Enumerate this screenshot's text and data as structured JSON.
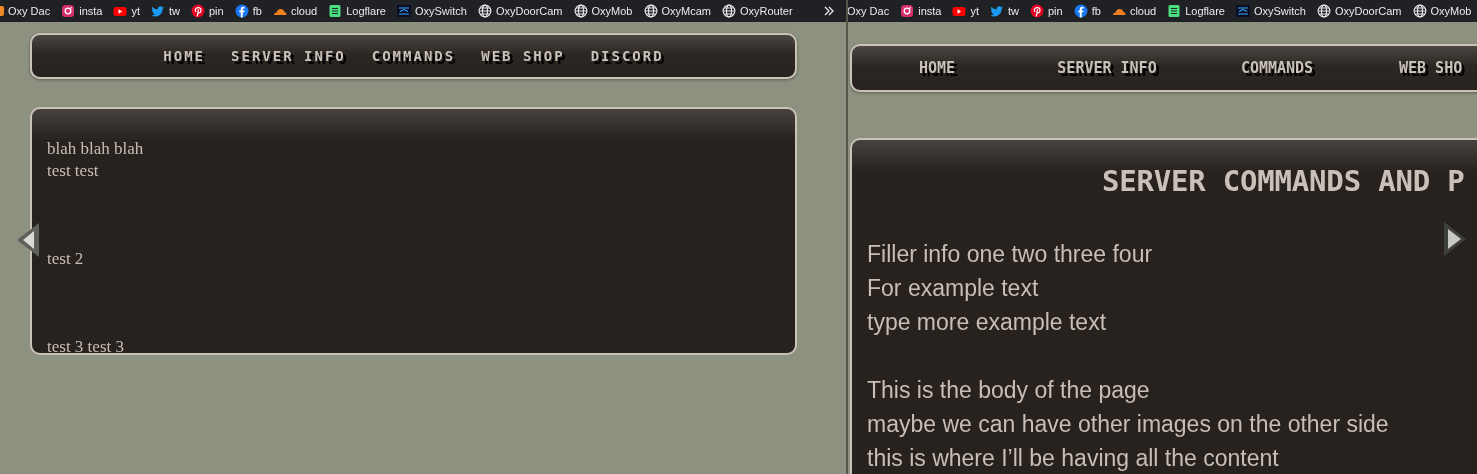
{
  "windows": [
    {
      "bookmarks": [
        {
          "label": "Oxy Dac",
          "kind": "dac"
        },
        {
          "label": "insta",
          "kind": "instagram"
        },
        {
          "label": "yt",
          "kind": "youtube"
        },
        {
          "label": "tw",
          "kind": "twitter"
        },
        {
          "label": "pin",
          "kind": "pinterest"
        },
        {
          "label": "fb",
          "kind": "facebook"
        },
        {
          "label": "cloud",
          "kind": "cloud"
        },
        {
          "label": "Logflare",
          "kind": "logflare"
        },
        {
          "label": "OxySwitch",
          "kind": "switch"
        },
        {
          "label": "OxyDoorCam",
          "kind": "globe"
        },
        {
          "label": "OxyMob",
          "kind": "globe"
        },
        {
          "label": "OxyMcam",
          "kind": "globe"
        },
        {
          "label": "OxyRouter",
          "kind": "globe"
        }
      ],
      "nav": [
        "HOME",
        "SERVER INFO",
        "COMMANDS",
        "WEB SHOP",
        "DISCORD"
      ],
      "content": {
        "blocks": [
          [
            "blah blah blah",
            "test test"
          ],
          [
            "test 2"
          ],
          [
            "test 3 test 3"
          ]
        ]
      },
      "arrow": {
        "kind": "left"
      }
    },
    {
      "bookmarks": [
        {
          "label": "Oxy Dac",
          "kind": "none"
        },
        {
          "label": "insta",
          "kind": "instagram"
        },
        {
          "label": "yt",
          "kind": "youtube"
        },
        {
          "label": "tw",
          "kind": "twitter"
        },
        {
          "label": "pin",
          "kind": "pinterest"
        },
        {
          "label": "fb",
          "kind": "facebook"
        },
        {
          "label": "cloud",
          "kind": "cloud"
        },
        {
          "label": "Logflare",
          "kind": "logflare"
        },
        {
          "label": "OxySwitch",
          "kind": "switch"
        },
        {
          "label": "OxyDoorCam",
          "kind": "globe"
        },
        {
          "label": "OxyMob",
          "kind": "globe"
        }
      ],
      "nav": [
        "HOME",
        "SERVER INFO",
        "COMMANDS",
        "WEB SHO"
      ],
      "content": {
        "title": "SERVER COMMANDS AND P",
        "blocks": [
          [
            "Filler info one two three four",
            "For example text",
            "type more example text"
          ],
          [
            "This is the body of the page",
            "maybe we can have other images on the other side",
            "this is where I’ll be having all the content"
          ]
        ]
      },
      "arrow": {
        "kind": "right"
      }
    }
  ]
}
